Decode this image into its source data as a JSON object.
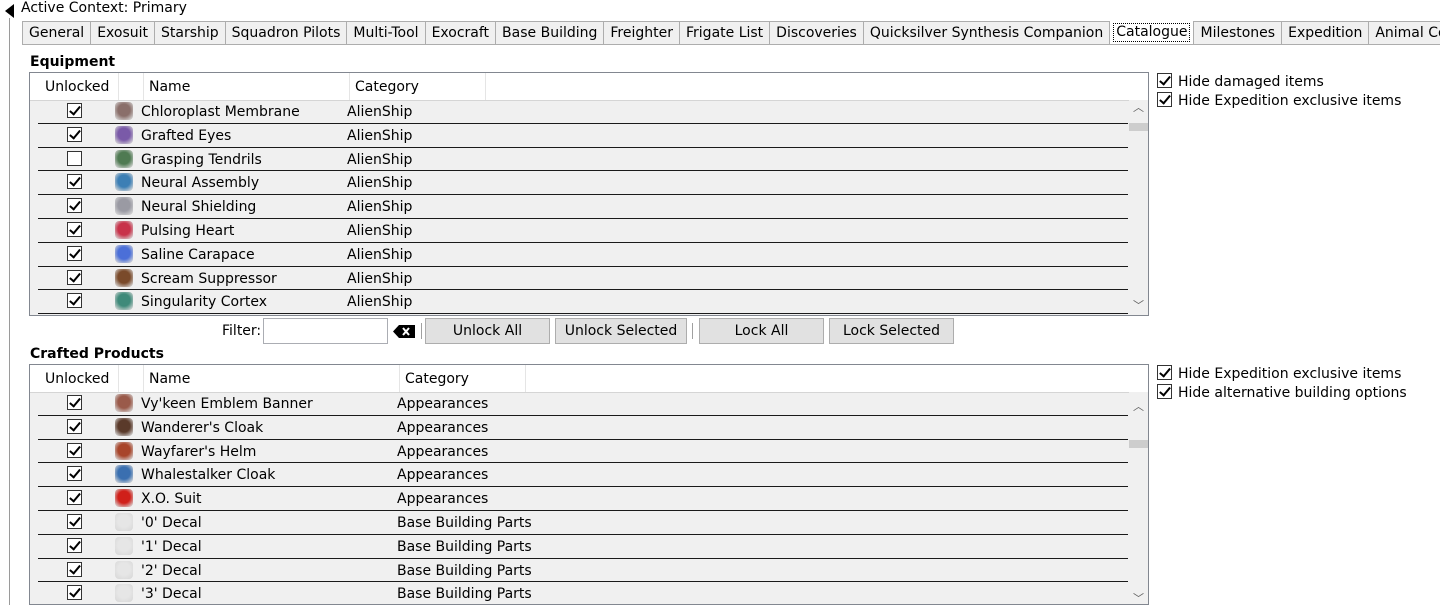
{
  "context": {
    "title": "Active Context: Primary"
  },
  "tabs": [
    {
      "label": "General"
    },
    {
      "label": "Exosuit"
    },
    {
      "label": "Starship"
    },
    {
      "label": "Squadron Pilots"
    },
    {
      "label": "Multi-Tool"
    },
    {
      "label": "Exocraft"
    },
    {
      "label": "Base Building"
    },
    {
      "label": "Freighter"
    },
    {
      "label": "Frigate List"
    },
    {
      "label": "Discoveries"
    },
    {
      "label": "Quicksilver Synthesis Companion"
    },
    {
      "label": "Catalogue",
      "active": true
    },
    {
      "label": "Milestones"
    },
    {
      "label": "Expedition"
    },
    {
      "label": "Animal Companions"
    }
  ],
  "equipment": {
    "title": "Equipment",
    "columns": {
      "unlocked": "Unlocked",
      "name": "Name",
      "category": "Category"
    },
    "rows": [
      {
        "checked": true,
        "name": "Chloroplast Membrane",
        "category": "AlienShip",
        "icon_color": "#8a6f6a"
      },
      {
        "checked": true,
        "name": "Grafted Eyes",
        "category": "AlienShip",
        "icon_color": "#7a5aa8"
      },
      {
        "checked": false,
        "name": "Grasping Tendrils",
        "category": "AlienShip",
        "icon_color": "#4f7a52"
      },
      {
        "checked": true,
        "name": "Neural Assembly",
        "category": "AlienShip",
        "icon_color": "#3c7fb5"
      },
      {
        "checked": true,
        "name": "Neural Shielding",
        "category": "AlienShip",
        "icon_color": "#9a9aa3"
      },
      {
        "checked": true,
        "name": "Pulsing Heart",
        "category": "AlienShip",
        "icon_color": "#c8324a"
      },
      {
        "checked": true,
        "name": "Saline Carapace",
        "category": "AlienShip",
        "icon_color": "#4b6fd8"
      },
      {
        "checked": true,
        "name": "Scream Suppressor",
        "category": "AlienShip",
        "icon_color": "#7a4a2a"
      },
      {
        "checked": true,
        "name": "Singularity Cortex",
        "category": "AlienShip",
        "icon_color": "#3f8a7a"
      }
    ],
    "options": [
      {
        "label": "Hide damaged items",
        "checked": true
      },
      {
        "label": "Hide Expedition exclusive items",
        "checked": true
      }
    ]
  },
  "toolbar": {
    "filter_label": "Filter:",
    "filter_value": "",
    "unlock_all": "Unlock All",
    "unlock_selected": "Unlock Selected",
    "lock_all": "Lock All",
    "lock_selected": "Lock Selected"
  },
  "crafted": {
    "title": "Crafted Products",
    "columns": {
      "unlocked": "Unlocked",
      "name": "Name",
      "category": "Category"
    },
    "rows": [
      {
        "checked": true,
        "name": "Vy'keen Emblem Banner",
        "category": "Appearances",
        "icon_color": "#9a5a4a"
      },
      {
        "checked": true,
        "name": "Wanderer's Cloak",
        "category": "Appearances",
        "icon_color": "#5a3a2a"
      },
      {
        "checked": true,
        "name": "Wayfarer's Helm",
        "category": "Appearances",
        "icon_color": "#a8452a"
      },
      {
        "checked": true,
        "name": "Whalestalker Cloak",
        "category": "Appearances",
        "icon_color": "#3a6fb0"
      },
      {
        "checked": true,
        "name": "X.O. Suit",
        "category": "Appearances",
        "icon_color": "#d0201a"
      },
      {
        "checked": true,
        "name": "'0' Decal",
        "category": "Base Building Parts",
        "icon_color": "#e6e6e6"
      },
      {
        "checked": true,
        "name": "'1' Decal",
        "category": "Base Building Parts",
        "icon_color": "#e6e6e6"
      },
      {
        "checked": true,
        "name": "'2' Decal",
        "category": "Base Building Parts",
        "icon_color": "#e6e6e6"
      },
      {
        "checked": true,
        "name": "'3' Decal",
        "category": "Base Building Parts",
        "icon_color": "#e6e6e6"
      }
    ],
    "options": [
      {
        "label": "Hide Expedition exclusive items",
        "checked": true
      },
      {
        "label": "Hide alternative building options",
        "checked": true
      }
    ]
  }
}
